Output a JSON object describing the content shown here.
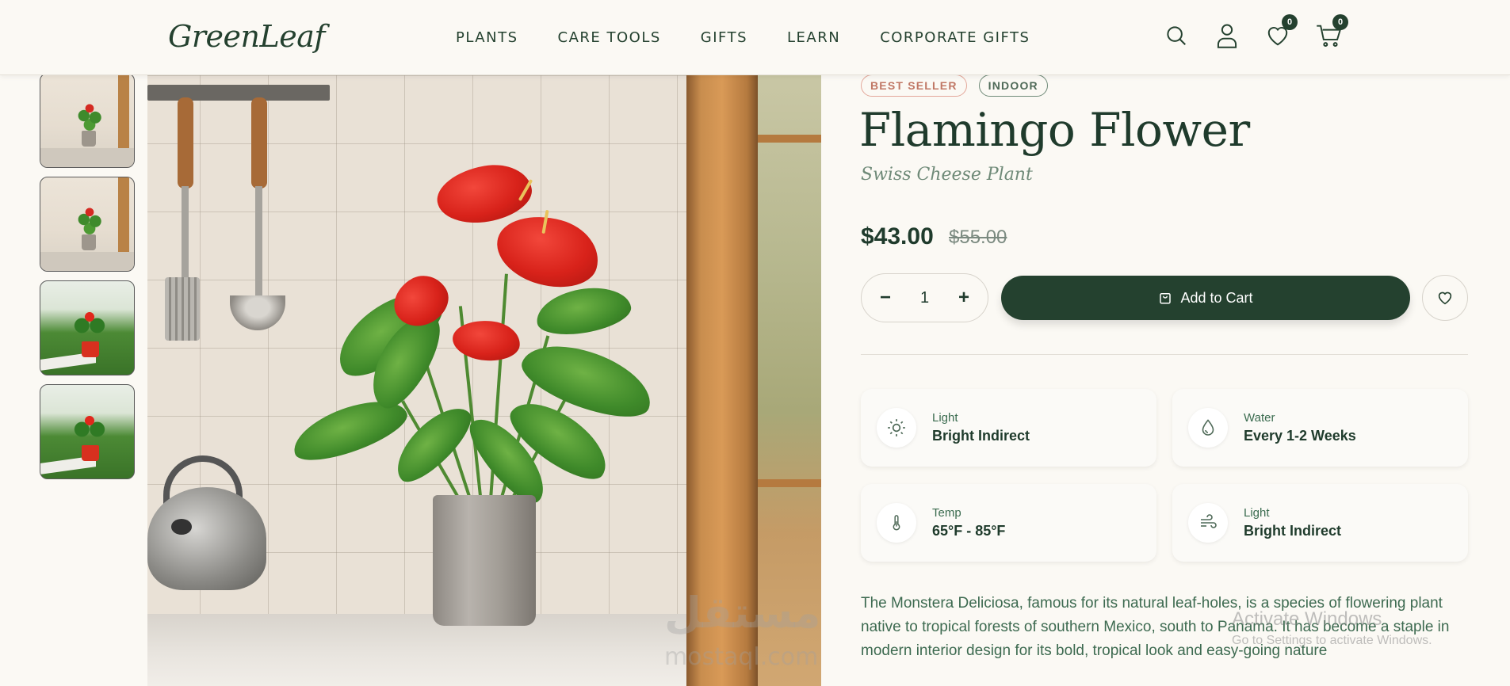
{
  "header": {
    "logo": "GreenLeaf",
    "nav": [
      "PLANTS",
      "CARE TOOLS",
      "GIFTS",
      "LEARN",
      "CORPORATE GIFTS"
    ],
    "wishlist_count": "0",
    "cart_count": "0"
  },
  "gallery": {
    "thumbnails": [
      "kitchen",
      "kitchen",
      "garden",
      "garden"
    ]
  },
  "watermark": {
    "arabic": "مستقل",
    "latin": "mostaql.com"
  },
  "product": {
    "tags": [
      "BEST SELLER",
      "INDOOR"
    ],
    "name": "Flamingo Flower",
    "subtitle": "Swiss Cheese Plant",
    "price": "$43.00",
    "old_price": "$55.00",
    "quantity": "1",
    "minus": "−",
    "plus": "+",
    "add_to_cart": "Add to Cart",
    "care": [
      {
        "icon": "sun-icon",
        "label": "Light",
        "value": "Bright Indirect"
      },
      {
        "icon": "water-drop-icon",
        "label": "Water",
        "value": "Every 1-2 Weeks"
      },
      {
        "icon": "thermometer-icon",
        "label": "Temp",
        "value": "65°F - 85°F"
      },
      {
        "icon": "wind-icon",
        "label": "Light",
        "value": "Bright Indirect"
      }
    ],
    "description": "The Monstera Deliciosa, famous for its natural leaf-holes, is a species of flowering plant native to tropical forests of southern Mexico, south to Panama. It has become a staple in modern interior design for its bold, tropical look and easy-going nature"
  },
  "os_overlay": {
    "title": "Activate Windows",
    "subtitle": "Go to Settings to activate Windows."
  },
  "colors": {
    "primary": "#24412f",
    "background": "#fbf9f4",
    "best_seller": "#c07765",
    "indoor": "#4f6a58"
  }
}
